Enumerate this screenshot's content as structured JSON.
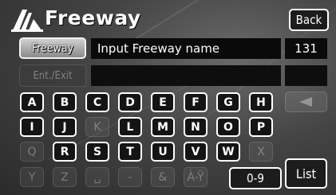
{
  "header": {
    "title": "Freeway",
    "back_label": "Back"
  },
  "name_row": {
    "field_label": "Freeway",
    "input_value": "Input Freeway name",
    "count": "131"
  },
  "entexit_row": {
    "label": "Ent./Exit",
    "input_value": "",
    "count": ""
  },
  "keyboard": {
    "rows": [
      [
        {
          "label": "A",
          "enabled": true
        },
        {
          "label": "B",
          "enabled": true
        },
        {
          "label": "C",
          "enabled": true
        },
        {
          "label": "D",
          "enabled": true
        },
        {
          "label": "E",
          "enabled": true
        },
        {
          "label": "F",
          "enabled": true
        },
        {
          "label": "G",
          "enabled": true
        },
        {
          "label": "H",
          "enabled": true
        }
      ],
      [
        {
          "label": "I",
          "enabled": true
        },
        {
          "label": "J",
          "enabled": true
        },
        {
          "label": "K",
          "enabled": false
        },
        {
          "label": "L",
          "enabled": true
        },
        {
          "label": "M",
          "enabled": true
        },
        {
          "label": "N",
          "enabled": true
        },
        {
          "label": "O",
          "enabled": true
        },
        {
          "label": "P",
          "enabled": true
        }
      ],
      [
        {
          "label": "Q",
          "enabled": false
        },
        {
          "label": "R",
          "enabled": true
        },
        {
          "label": "S",
          "enabled": true
        },
        {
          "label": "T",
          "enabled": true
        },
        {
          "label": "U",
          "enabled": true
        },
        {
          "label": "V",
          "enabled": true
        },
        {
          "label": "W",
          "enabled": true
        },
        {
          "label": "X",
          "enabled": false
        }
      ],
      [
        {
          "label": "Y",
          "enabled": false
        },
        {
          "label": "Z",
          "enabled": false
        },
        {
          "label": "␣",
          "enabled": false
        },
        {
          "label": "-",
          "enabled": false
        },
        {
          "label": "&",
          "enabled": false
        },
        {
          "label": "À-Ÿ",
          "enabled": false
        }
      ]
    ],
    "backspace_icon": "backspace-arrow-icon",
    "range_label": "0-9",
    "list_label": "List"
  }
}
